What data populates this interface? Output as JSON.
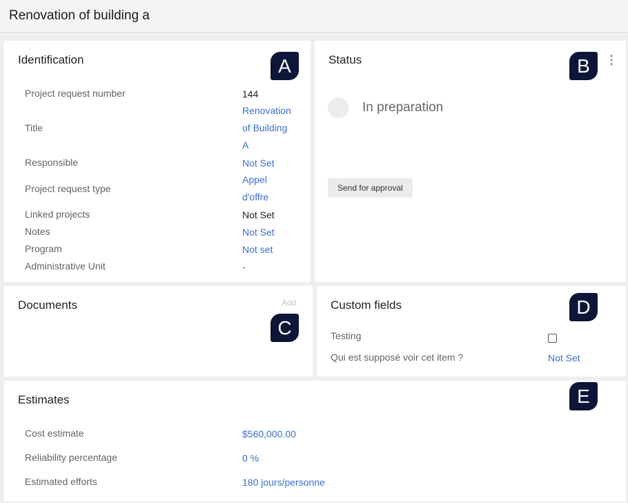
{
  "page": {
    "title": "Renovation of building a"
  },
  "identification": {
    "title": "Identification",
    "badge": "A",
    "rows": {
      "request_number": {
        "label": "Project request number",
        "value": "144"
      },
      "title": {
        "label": "Title",
        "value_lines": [
          "Renovation",
          "of Building",
          "A"
        ]
      },
      "responsible": {
        "label": "Responsible",
        "value": "Not Set"
      },
      "request_type": {
        "label": "Project request type",
        "value_lines": [
          "Appel",
          "d'offre"
        ]
      },
      "linked_projects": {
        "label": "Linked projects",
        "value": "Not Set"
      },
      "notes": {
        "label": "Notes",
        "value": "Not Set"
      },
      "program": {
        "label": "Program",
        "value": "Not set"
      },
      "admin_unit": {
        "label": "Administrative Unit",
        "value": "-"
      }
    }
  },
  "status": {
    "title": "Status",
    "badge": "B",
    "current": "In preparation",
    "send_button": "Send for approval"
  },
  "documents": {
    "title": "Documents",
    "badge": "C",
    "add_label": "Add"
  },
  "custom_fields": {
    "title": "Custom fields",
    "badge": "D",
    "testing": {
      "label": "Testing",
      "checked": false
    },
    "visibility": {
      "label": "Qui est supposé voir cet item ?",
      "value": "Not Set"
    }
  },
  "estimates": {
    "title": "Estimates",
    "badge": "E",
    "cost": {
      "label": "Cost estimate",
      "value": "$560,000.00"
    },
    "reliability": {
      "label": "Reliability percentage",
      "value": "0 %"
    },
    "efforts": {
      "label": "Estimated efforts",
      "value": "180 jours/personne"
    }
  }
}
